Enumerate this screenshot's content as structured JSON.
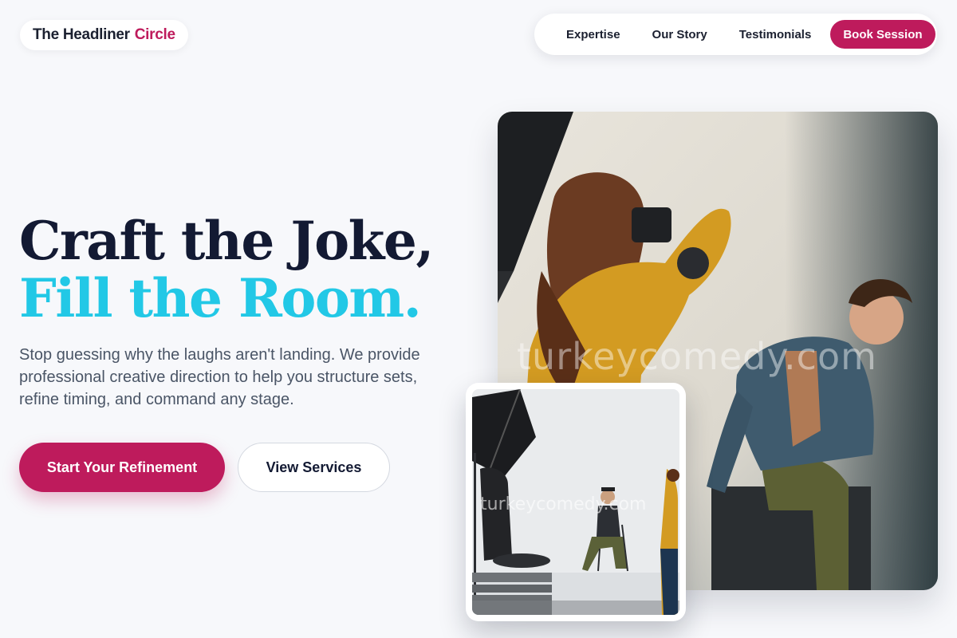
{
  "brand": {
    "name_part1": "The Headliner",
    "name_part2": "Circle"
  },
  "nav": {
    "items": [
      {
        "label": "Expertise"
      },
      {
        "label": "Our Story"
      },
      {
        "label": "Testimonials"
      }
    ],
    "cta_label": "Book Session"
  },
  "hero": {
    "headline_line1": "Craft the Joke,",
    "headline_line2": "Fill the Room.",
    "subtext": "Stop guessing why the laughs aren't landing. We provide professional creative direction to help you structure sets, refine timing, and command any stage.",
    "primary_button": "Start Your Refinement",
    "secondary_button": "View Services"
  },
  "images": {
    "main_watermark": "turkeycomedy.com",
    "inset_watermark": "turkeycomedy.com"
  },
  "colors": {
    "accent": "#be1b5c",
    "headline_dark": "#131a33",
    "headline_cyan": "#22c8e6",
    "background": "#f7f8fb"
  }
}
